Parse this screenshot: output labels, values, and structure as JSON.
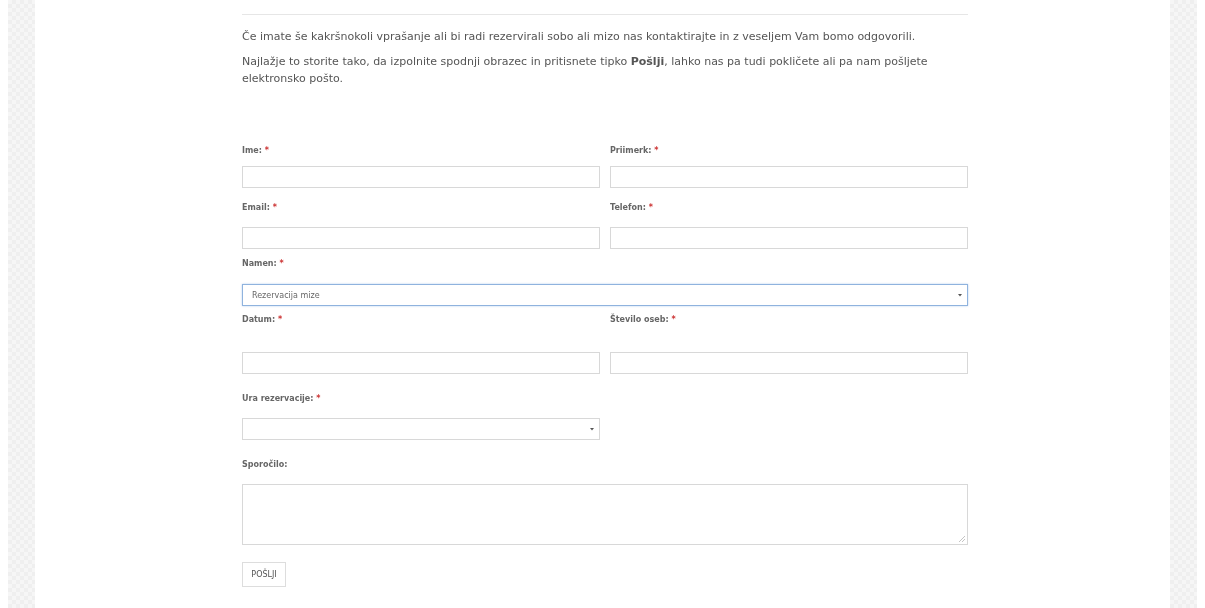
{
  "intro": [
    "Če imate še kakršnokoli vprašanje ali bi radi rezervirali sobo ali mizo nas kontaktirajte in z veseljem Vam bomo odgovorili.",
    "Najlažje to storite tako, da izpolnite spodnji obrazec in pritisnete tipko **Pošlji**, lahko nas pa tudi pokličete ali pa nam pošljete elektronsko pošto."
  ],
  "form": {
    "rows": [
      [
        {
          "label": "Ime:",
          "required_mark": "*",
          "kind": "text"
        },
        {
          "label": "Priimerk:",
          "required_mark": "*",
          "kind": "text"
        }
      ],
      [
        {
          "label": "Email:",
          "required_mark": "*",
          "kind": "text"
        },
        {
          "label": "Telefon:",
          "required_mark": "*",
          "kind": "text"
        }
      ],
      [
        {
          "label": "Namen:",
          "required_mark": "*",
          "kind": "select",
          "value": "Rezervacija mize",
          "focused": true
        }
      ],
      [
        {
          "label": "Datum:",
          "required_mark": "*",
          "kind": "text"
        },
        {
          "label": "Število oseb:",
          "required_mark": "*",
          "kind": "text"
        }
      ],
      [
        {
          "label": "Ura rezervacije:",
          "required_mark": "*",
          "kind": "select",
          "focused": false
        },
        {
          "kind": "blank"
        }
      ],
      [
        {
          "label": "Sporočilo:",
          "kind": "textarea"
        }
      ]
    ],
    "submit": "POŠLJI"
  }
}
